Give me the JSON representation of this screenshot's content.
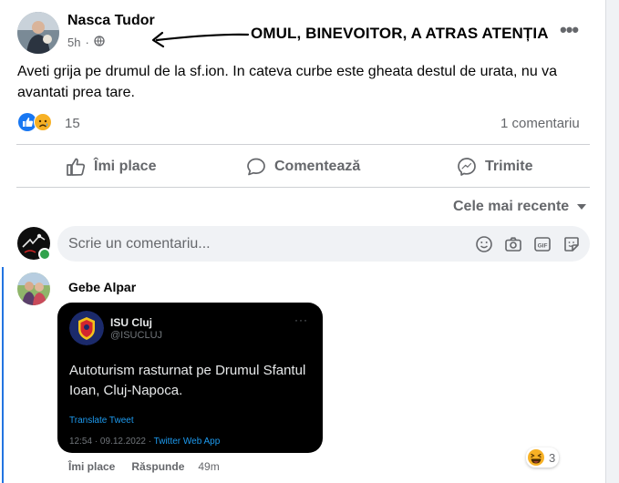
{
  "post": {
    "author": "Nasca Tudor",
    "time": "5h",
    "privacy_icon": "globe-icon",
    "text": "Aveti grija pe drumul de la sf.ion. In cateva curbe este gheata destul de urata, nu va avantati prea tare.",
    "reaction_count": "15",
    "comment_count": "1 comentariu",
    "reaction_icons": [
      "like-icon",
      "sad-icon"
    ]
  },
  "annotation": {
    "text": "OMUL, BINEVOITOR, A ATRAS ATENȚIA"
  },
  "actions": {
    "like": "Îmi place",
    "comment": "Comentează",
    "share": "Trimite"
  },
  "comments_section": {
    "sort_label": "Cele mai recente",
    "input_placeholder": "Scrie un comentariu..."
  },
  "comment": {
    "author": "Gebe Alpar",
    "like_label": "Îmi place",
    "reply_label": "Răspunde",
    "time": "49m",
    "reaction_count": "3",
    "reaction_icon": "haha-icon"
  },
  "tweet": {
    "name": "ISU Cluj",
    "handle": "@ISUCLUJ",
    "text": "Autoturism rasturnat pe Drumul Sfantul Ioan, Cluj-Napoca.",
    "translate": "Translate Tweet",
    "timestamp": "12:54 · 09.12.2022 · ",
    "app": "Twitter Web App"
  },
  "colors": {
    "facebook_blue": "#2374e1",
    "muted_text": "#65676b",
    "tweet_bg": "#000000",
    "twitter_blue": "#1d9bf0"
  }
}
